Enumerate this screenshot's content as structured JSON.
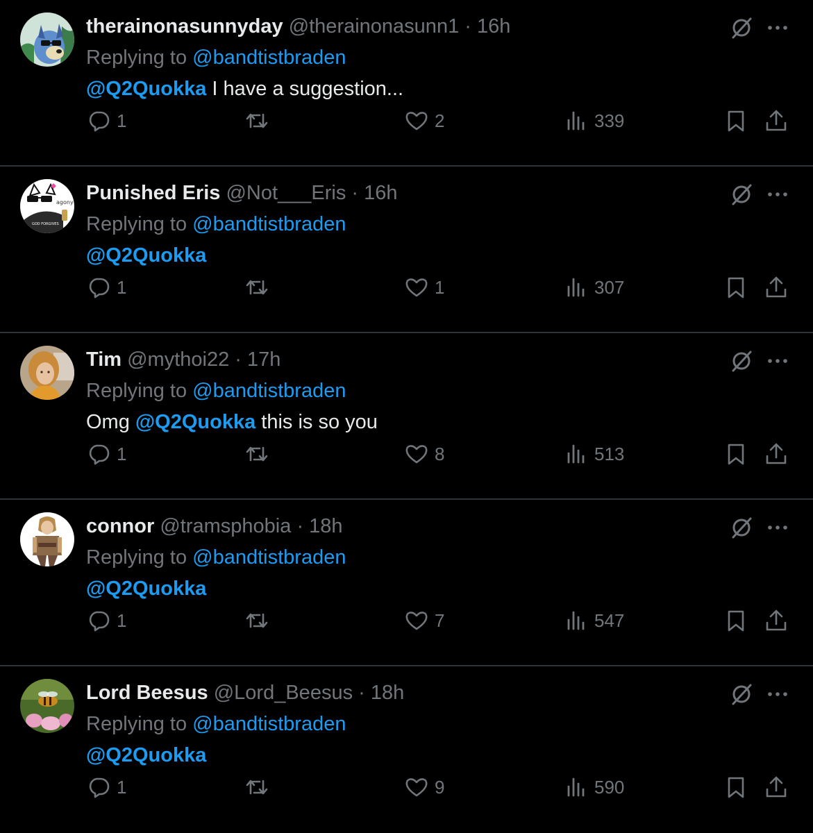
{
  "replies": [
    {
      "display_name": "therainonasunnyday",
      "handle": "@therainonasunn1",
      "separator": "·",
      "time": "16h",
      "replying_prefix": "Replying to",
      "replying_to": "@bandtistbraden",
      "body_pre": "",
      "body_mention": "@Q2Quokka",
      "body_post": " I have a suggestion...",
      "reply_count": "1",
      "repost_count": "",
      "like_count": "2",
      "view_count": "339",
      "avatar_icon": "avatar-bluey-cartoon"
    },
    {
      "display_name": "Punished Eris",
      "handle": "@Not___Eris",
      "separator": "·",
      "time": "16h",
      "replying_prefix": "Replying to",
      "replying_to": "@bandtistbraden",
      "body_pre": "",
      "body_mention": "@Q2Quokka",
      "body_post": "",
      "reply_count": "1",
      "repost_count": "",
      "like_count": "1",
      "view_count": "307",
      "avatar_icon": "avatar-cat-sunglasses-drawing",
      "avatar_text": "agony"
    },
    {
      "display_name": "Tim",
      "handle": "@mythoi22",
      "separator": "·",
      "time": "17h",
      "replying_prefix": "Replying to",
      "replying_to": "@bandtistbraden",
      "body_pre": "Omg ",
      "body_mention": "@Q2Quokka",
      "body_post": " this is so you",
      "reply_count": "1",
      "repost_count": "",
      "like_count": "8",
      "view_count": "513",
      "avatar_icon": "avatar-person-photo"
    },
    {
      "display_name": "connor",
      "handle": "@tramsphobia",
      "separator": "·",
      "time": "18h",
      "replying_prefix": "Replying to",
      "replying_to": "@bandtistbraden",
      "body_pre": "",
      "body_mention": "@Q2Quokka",
      "body_post": "",
      "reply_count": "1",
      "repost_count": "",
      "like_count": "7",
      "view_count": "547",
      "avatar_icon": "avatar-game-character-art"
    },
    {
      "display_name": "Lord Beesus",
      "handle": "@Lord_Beesus",
      "separator": "·",
      "time": "18h",
      "replying_prefix": "Replying to",
      "replying_to": "@bandtistbraden",
      "body_pre": "",
      "body_mention": "@Q2Quokka",
      "body_post": "",
      "reply_count": "1",
      "repost_count": "",
      "like_count": "9",
      "view_count": "590",
      "avatar_icon": "avatar-bee-on-flower"
    }
  ],
  "icons": {
    "grok": "grok-icon",
    "more": "more-options-icon",
    "reply": "reply-icon",
    "repost": "repost-icon",
    "like": "like-icon",
    "views": "views-icon",
    "bookmark": "bookmark-icon",
    "share": "share-icon"
  },
  "colors": {
    "background": "#000000",
    "text": "#e7e9ea",
    "secondary": "#71767b",
    "accent": "#1d9bf0",
    "divider": "#2f3336"
  }
}
